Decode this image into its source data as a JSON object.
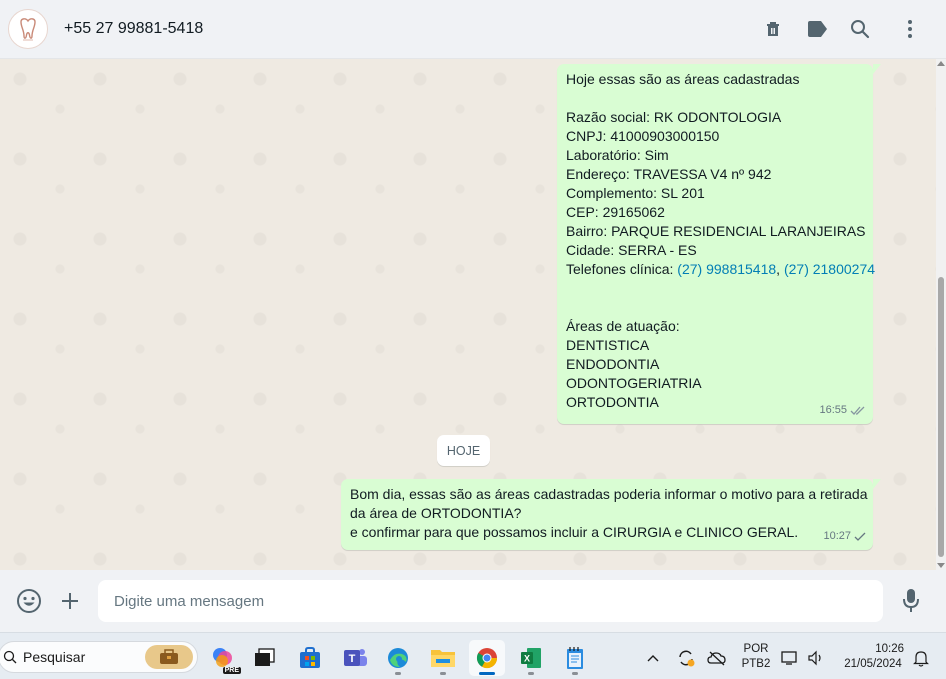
{
  "header": {
    "contact_name": "+55 27 99881-5418",
    "icons": [
      "archive-icon",
      "label-icon",
      "search-icon",
      "menu-icon"
    ]
  },
  "messages": [
    {
      "lines": [
        "Hoje essas são as áreas cadastradas",
        "",
        "Razão social: RK ODONTOLOGIA",
        "CNPJ: 41000903000150",
        "Laboratório: Sim",
        "Endereço: TRAVESSA V4 nº 942",
        "Complemento: SL 201",
        "CEP: 29165062",
        "Bairro: PARQUE RESIDENCIAL LARANJEIRAS",
        "Cidade: SERRA - ES"
      ],
      "phones_label": "Telefones clínica: ",
      "phone_1": "(27) 998815418",
      "phone_sep": ", ",
      "phone_2": "(27) 21800274",
      "lines_after": [
        "",
        "",
        "Áreas de atuação:",
        "DENTISTICA",
        "ENDODONTIA",
        "ODONTOGERIATRIA",
        "ORTODONTIA"
      ],
      "time": "16:55",
      "status": "read"
    },
    {
      "lines": [
        "Bom dia, essas são as áreas cadastradas poderia informar o motivo para a retirada",
        "da área de ORTODONTIA?",
        "e confirmar para que possamos incluir a CIRURGIA e CLINICO GERAL."
      ],
      "time": "10:27",
      "status": "sent"
    }
  ],
  "date_chip": "HOJE",
  "composer": {
    "placeholder": "Digite uma mensagem"
  },
  "taskbar": {
    "search_label": "Pesquisar",
    "language_line1": "POR",
    "language_line2": "PTB2",
    "time": "10:26",
    "date": "21/05/2024",
    "pre_badge": "PRE"
  },
  "colors": {
    "outgoing_bubble": "#d9fdd3",
    "link": "#027eb5",
    "read_tick": "#53bdeb",
    "header_bg": "#f0f2f5"
  }
}
